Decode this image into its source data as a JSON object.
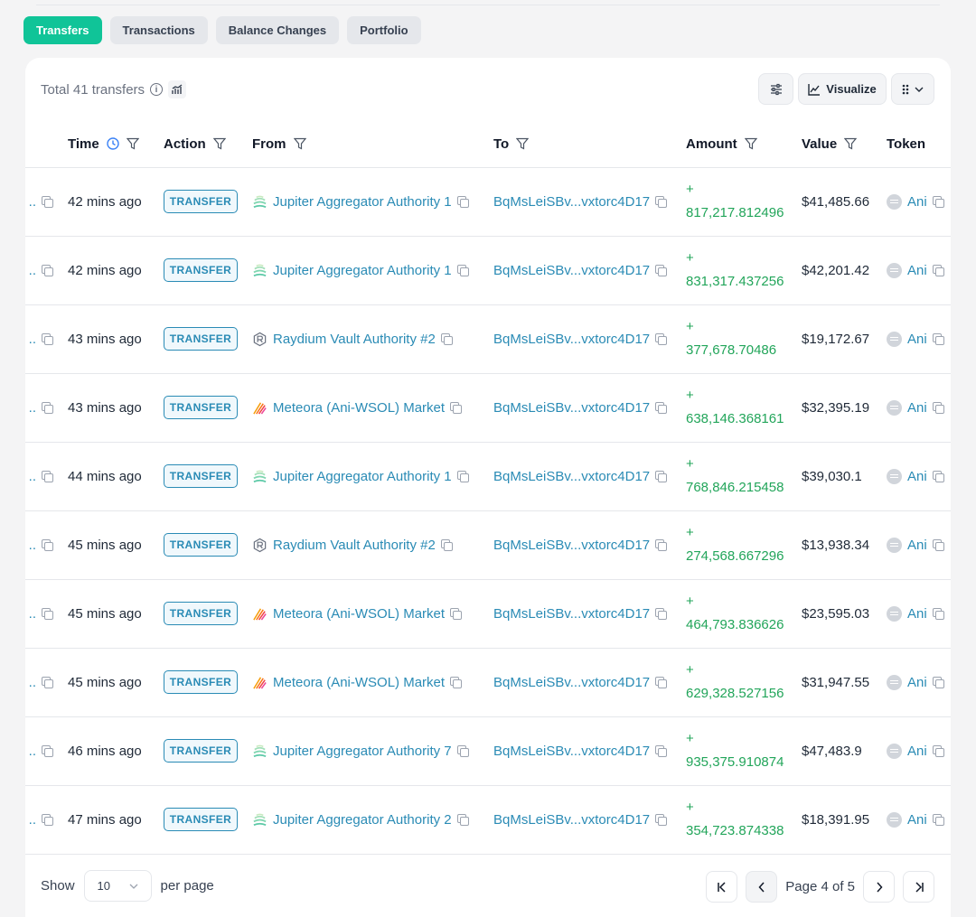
{
  "tabs": [
    "Transfers",
    "Transactions",
    "Balance Changes",
    "Portfolio"
  ],
  "header": {
    "total_label": "Total 41 transfers",
    "visualize_label": "Visualize"
  },
  "columns": {
    "time": "Time",
    "action": "Action",
    "from": "From",
    "to": "To",
    "amount": "Amount",
    "value": "Value",
    "token": "Token"
  },
  "rows": [
    {
      "sig": "..",
      "time": "42 mins ago",
      "action": "TRANSFER",
      "from": "Jupiter Aggregator Authority 1",
      "from_icon": "jupiter-icon",
      "to": "BqMsLeiSBv...vxtorc4D17",
      "amount_sign": "+",
      "amount": "817,217.812496",
      "value": "$41,485.66",
      "token": "Ani"
    },
    {
      "sig": "..",
      "time": "42 mins ago",
      "action": "TRANSFER",
      "from": "Jupiter Aggregator Authority 1",
      "from_icon": "jupiter-icon",
      "to": "BqMsLeiSBv...vxtorc4D17",
      "amount_sign": "+",
      "amount": "831,317.437256",
      "value": "$42,201.42",
      "token": "Ani"
    },
    {
      "sig": "..",
      "time": "43 mins ago",
      "action": "TRANSFER",
      "from": "Raydium Vault Authority #2",
      "from_icon": "raydium-icon",
      "to": "BqMsLeiSBv...vxtorc4D17",
      "amount_sign": "+",
      "amount": "377,678.70486",
      "value": "$19,172.67",
      "token": "Ani"
    },
    {
      "sig": "..",
      "time": "43 mins ago",
      "action": "TRANSFER",
      "from": "Meteora (Ani-WSOL) Market",
      "from_icon": "meteora-icon",
      "to": "BqMsLeiSBv...vxtorc4D17",
      "amount_sign": "+",
      "amount": "638,146.368161",
      "value": "$32,395.19",
      "token": "Ani"
    },
    {
      "sig": "..",
      "time": "44 mins ago",
      "action": "TRANSFER",
      "from": "Jupiter Aggregator Authority 1",
      "from_icon": "jupiter-icon",
      "to": "BqMsLeiSBv...vxtorc4D17",
      "amount_sign": "+",
      "amount": "768,846.215458",
      "value": "$39,030.1",
      "token": "Ani"
    },
    {
      "sig": "..",
      "time": "45 mins ago",
      "action": "TRANSFER",
      "from": "Raydium Vault Authority #2",
      "from_icon": "raydium-icon",
      "to": "BqMsLeiSBv...vxtorc4D17",
      "amount_sign": "+",
      "amount": "274,568.667296",
      "value": "$13,938.34",
      "token": "Ani"
    },
    {
      "sig": "..",
      "time": "45 mins ago",
      "action": "TRANSFER",
      "from": "Meteora (Ani-WSOL) Market",
      "from_icon": "meteora-icon",
      "to": "BqMsLeiSBv...vxtorc4D17",
      "amount_sign": "+",
      "amount": "464,793.836626",
      "value": "$23,595.03",
      "token": "Ani"
    },
    {
      "sig": "..",
      "time": "45 mins ago",
      "action": "TRANSFER",
      "from": "Meteora (Ani-WSOL) Market",
      "from_icon": "meteora-icon",
      "to": "BqMsLeiSBv...vxtorc4D17",
      "amount_sign": "+",
      "amount": "629,328.527156",
      "value": "$31,947.55",
      "token": "Ani"
    },
    {
      "sig": "..",
      "time": "46 mins ago",
      "action": "TRANSFER",
      "from": "Jupiter Aggregator Authority 7",
      "from_icon": "jupiter-icon",
      "to": "BqMsLeiSBv...vxtorc4D17",
      "amount_sign": "+",
      "amount": "935,375.910874",
      "value": "$47,483.9",
      "token": "Ani"
    },
    {
      "sig": "..",
      "time": "47 mins ago",
      "action": "TRANSFER",
      "from": "Jupiter Aggregator Authority 2",
      "from_icon": "jupiter-icon",
      "to": "BqMsLeiSBv...vxtorc4D17",
      "amount_sign": "+",
      "amount": "354,723.874338",
      "value": "$18,391.95",
      "token": "Ani"
    }
  ],
  "footer": {
    "show_label": "Show",
    "page_size": "10",
    "per_page_label": "per page",
    "page_info": "Page 4 of 5"
  },
  "colors": {
    "accent": "#10c498",
    "link": "#2a8bb5",
    "amount_positive": "#22a55a"
  }
}
